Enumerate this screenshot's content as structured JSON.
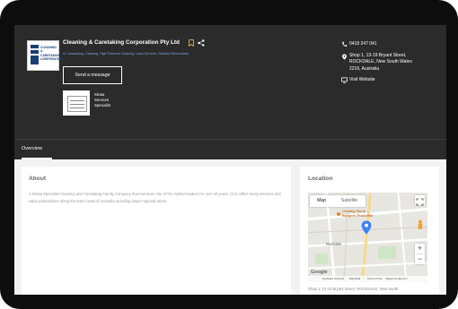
{
  "business": {
    "name": "Cleaning & Caretaking Corporation Pty Ltd",
    "categories": "In Carwashing, Cleaning, High Pressure Cleaning, Lawn Services, Rubbish Removalists",
    "send_button": "Send a message",
    "specialist": [
      "Strata",
      "Services",
      "Specialist"
    ],
    "logo_text": [
      "CLEANING &",
      "CARETAKING",
      "CORPORATION"
    ]
  },
  "contact": {
    "phone": "0418 247 041",
    "address": [
      "Shop 1, 13-19 Bryant Street,",
      "ROCKDALE, New South Wales",
      "2216, Australia"
    ],
    "website_label": "Visit Website"
  },
  "nav": {
    "tabs": [
      "Overview"
    ]
  },
  "about": {
    "heading": "About",
    "text": "A Strata Specialist Cleaning and Caretaking Family Company that has been one of the market leaders for over 40 years. CCC offers many services and value propositions along the East Coast of Australia including larger regional areas."
  },
  "location": {
    "heading": "Location",
    "map_tab": "Map",
    "satellite_tab": "Satellite",
    "poi_label": "Chubby Buns Burgers Rockdale",
    "station_label": "Rockdale",
    "google": "Google",
    "footer": [
      "Keyboard shortcuts",
      "Map Data",
      "Terms of Use",
      "Report a map error"
    ],
    "address_line": "Shop 1, 13-19 Bryant Street, ROCKDALE, New South"
  },
  "colors": {
    "hero_bg": "#2b2b2b",
    "accent_link": "#7aa7e6",
    "pin": "#3b82f6"
  }
}
